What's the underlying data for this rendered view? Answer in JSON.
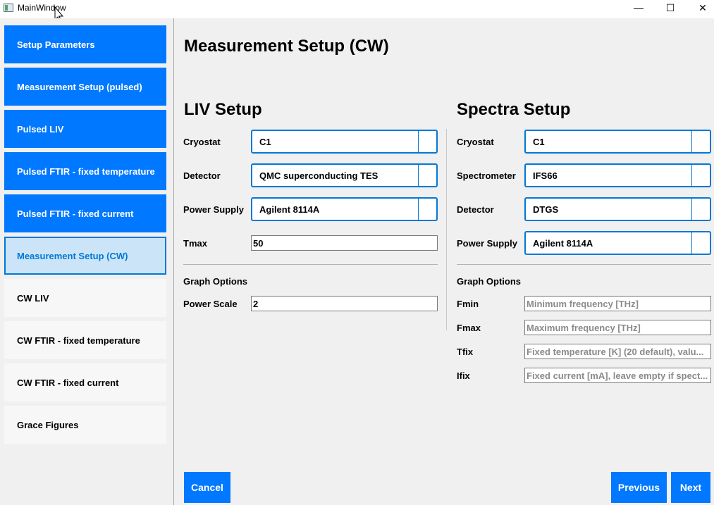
{
  "window": {
    "title": "MainWindow",
    "minimize_glyph": "—",
    "maximize_glyph": "☐",
    "close_glyph": "✕"
  },
  "sidebar": {
    "items": [
      {
        "label": "Setup Parameters",
        "state": "done"
      },
      {
        "label": "Measurement Setup (pulsed)",
        "state": "done"
      },
      {
        "label": "Pulsed LIV",
        "state": "done"
      },
      {
        "label": "Pulsed FTIR - fixed temperature",
        "state": "done"
      },
      {
        "label": "Pulsed FTIR - fixed current",
        "state": "done"
      },
      {
        "label": "Measurement Setup (CW)",
        "state": "active"
      },
      {
        "label": "CW LIV",
        "state": "todo"
      },
      {
        "label": "CW FTIR - fixed temperature",
        "state": "todo"
      },
      {
        "label": "CW FTIR - fixed current",
        "state": "todo"
      },
      {
        "label": "Grace Figures",
        "state": "todo"
      }
    ]
  },
  "main": {
    "title": "Measurement Setup (CW)",
    "liv": {
      "title": "LIV Setup",
      "cryostat_label": "Cryostat",
      "cryostat_value": "C1",
      "detector_label": "Detector",
      "detector_value": "QMC superconducting TES",
      "power_supply_label": "Power Supply",
      "power_supply_value": "Agilent 8114A",
      "tmax_label": "Tmax",
      "tmax_value": "50",
      "graph_options_label": "Graph Options",
      "power_scale_label": "Power Scale",
      "power_scale_value": "2"
    },
    "spectra": {
      "title": "Spectra Setup",
      "cryostat_label": "Cryostat",
      "cryostat_value": "C1",
      "spectrometer_label": "Spectrometer",
      "spectrometer_value": "IFS66",
      "detector_label": "Detector",
      "detector_value": "DTGS",
      "power_supply_label": "Power Supply",
      "power_supply_value": "Agilent 8114A",
      "graph_options_label": "Graph Options",
      "fmin_label": "Fmin",
      "fmin_placeholder": "Minimum frequency [THz]",
      "fmax_label": "Fmax",
      "fmax_placeholder": "Maximum frequency [THz]",
      "tfix_label": "Tfix",
      "tfix_placeholder": "Fixed temperature [K] (20 default), valu...",
      "ifix_label": "Ifix",
      "ifix_placeholder": "Fixed current [mA], leave empty if spect..."
    },
    "buttons": {
      "cancel": "Cancel",
      "previous": "Previous",
      "next": "Next"
    }
  },
  "colors": {
    "accent": "#0078ff",
    "active_bg": "#cce4f7",
    "active_border": "#0078d7"
  }
}
